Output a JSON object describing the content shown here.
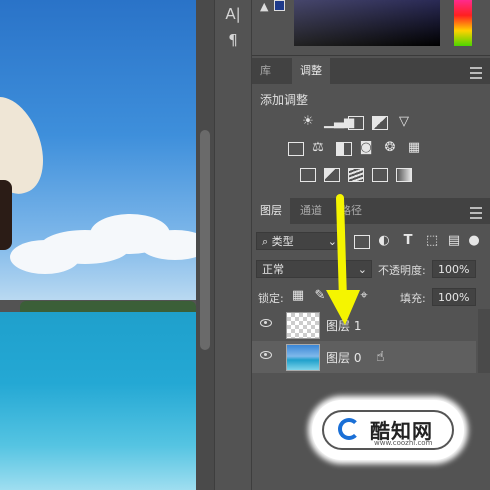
{
  "toolstrip": {
    "icons": [
      "character-icon",
      "paragraph-icon"
    ]
  },
  "tabs_top": {
    "library": "库",
    "adjustments": "调整"
  },
  "adjustments": {
    "title": "添加调整",
    "row1": [
      "brightness-icon",
      "levels-icon",
      "curves-icon",
      "exposure-icon",
      "vibrance-icon"
    ],
    "row2": [
      "hue-saturation-icon",
      "color-balance-icon",
      "black-white-icon",
      "photo-filter-icon",
      "channel-mixer-icon",
      "color-lookup-icon"
    ],
    "row3": [
      "invert-icon",
      "posterize-icon",
      "threshold-icon",
      "selective-color-icon",
      "gradient-map-icon"
    ]
  },
  "layers_tabs": {
    "layers": "图层",
    "channels": "通道",
    "paths": "路径"
  },
  "filter": {
    "kind_label": "类型"
  },
  "blend": {
    "mode": "正常",
    "opacity_label": "不透明度:",
    "opacity_value": "100%"
  },
  "lock": {
    "label": "锁定:",
    "fill_label": "填充:",
    "fill_value": "100%"
  },
  "layers": [
    {
      "name": "图层 1",
      "thumbnail": "transparent"
    },
    {
      "name": "图层 0",
      "thumbnail": "beach-photo"
    }
  ],
  "watermark": {
    "text": "酷知网",
    "url": "www.coozhi.com"
  },
  "colors": {
    "panel": "#535353",
    "tabbar": "#424242",
    "arrow": "#f5f500",
    "selected_layer": "#5f5f5f"
  }
}
